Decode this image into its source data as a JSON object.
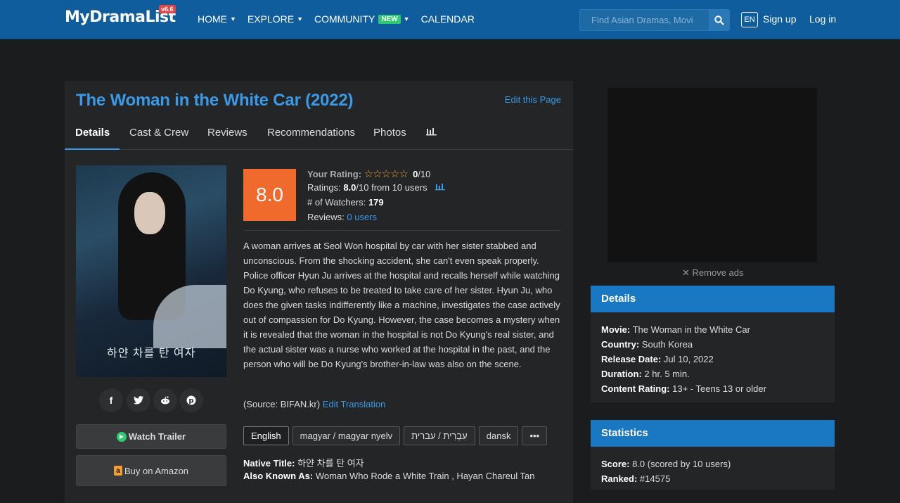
{
  "header": {
    "logo": "MyDramaList",
    "version_badge": "v6.6",
    "nav": [
      {
        "label": "HOME",
        "caret": true
      },
      {
        "label": "EXPLORE",
        "caret": true
      },
      {
        "label": "COMMUNITY",
        "caret": true,
        "badge": "NEW"
      },
      {
        "label": "CALENDAR",
        "caret": false
      }
    ],
    "search_placeholder": "Find Asian Dramas, Movi",
    "lang": "EN",
    "signup": "Sign up",
    "login": "Log in"
  },
  "drama": {
    "title": "The Woman in the White Car (2022)",
    "edit_link": "Edit this Page",
    "tabs": [
      "Details",
      "Cast & Crew",
      "Reviews",
      "Recommendations",
      "Photos"
    ],
    "poster_text": "하얀 차를 탄 여자",
    "score": "8.0",
    "your_rating_label": "Your Rating:",
    "your_rating_value": "0",
    "your_rating_max": "/10",
    "stars_filled": 0,
    "stars_total": 5,
    "ratings_label": "Ratings:",
    "ratings_value": "8.0",
    "ratings_suffix": "/10 from 10 users",
    "watchers_label": "# of Watchers:",
    "watchers_value": "179",
    "reviews_label": "Reviews:",
    "reviews_value": "0 users",
    "synopsis": "A woman arrives at Seol Won hospital by car with her sister stabbed and unconscious. From the shocking accident, she can't even speak properly. Police officer Hyun Ju arrives at the hospital and recalls herself while watching Do Kyung, who refuses to be treated to take care of her sister. Hyun Ju, who does the given tasks indifferently like a machine, investigates the case actively out of compassion for Do Kyung. However, the case becomes a mystery when it is revealed that the woman in the hospital is not Do Kyung's real sister, and the actual sister was a nurse who worked at the hospital in the past, and the person who will be Do Kyung's brother-in-law was also on the scene.",
    "source_text": "(Source: BIFAN.kr)",
    "edit_translation": "Edit Translation",
    "languages": [
      "English",
      "magyar / magyar nyelv",
      "עִבְרִית / עברית",
      "dansk",
      "•••"
    ],
    "native_title_label": "Native Title:",
    "native_title_value": "하얀 차를 탄 여자",
    "aka_label": "Also Known As:",
    "aka_value": "Woman Who Rode a White Train , Hayan Chareul Tan",
    "watch_trailer": "Watch Trailer",
    "buy_amazon": "Buy on Amazon"
  },
  "sidebar": {
    "remove_ads": "Remove ads",
    "details_title": "Details",
    "details": [
      {
        "label": "Movie:",
        "value": "The Woman in the White Car"
      },
      {
        "label": "Country:",
        "value": "South Korea"
      },
      {
        "label": "Release Date:",
        "value": "Jul 10, 2022"
      },
      {
        "label": "Duration:",
        "value": "2 hr. 5 min."
      },
      {
        "label": "Content Rating:",
        "value": "13+ - Teens 13 or older"
      }
    ],
    "stats_title": "Statistics",
    "stats": [
      {
        "label": "Score:",
        "value": "8.0 (scored by 10 users)"
      },
      {
        "label": "Ranked:",
        "value": "#14575"
      }
    ]
  },
  "colors": {
    "header": "#0f5d9c",
    "accent": "#3a9ae8",
    "score": "#f06a2d",
    "box_head": "#1a78c2"
  }
}
